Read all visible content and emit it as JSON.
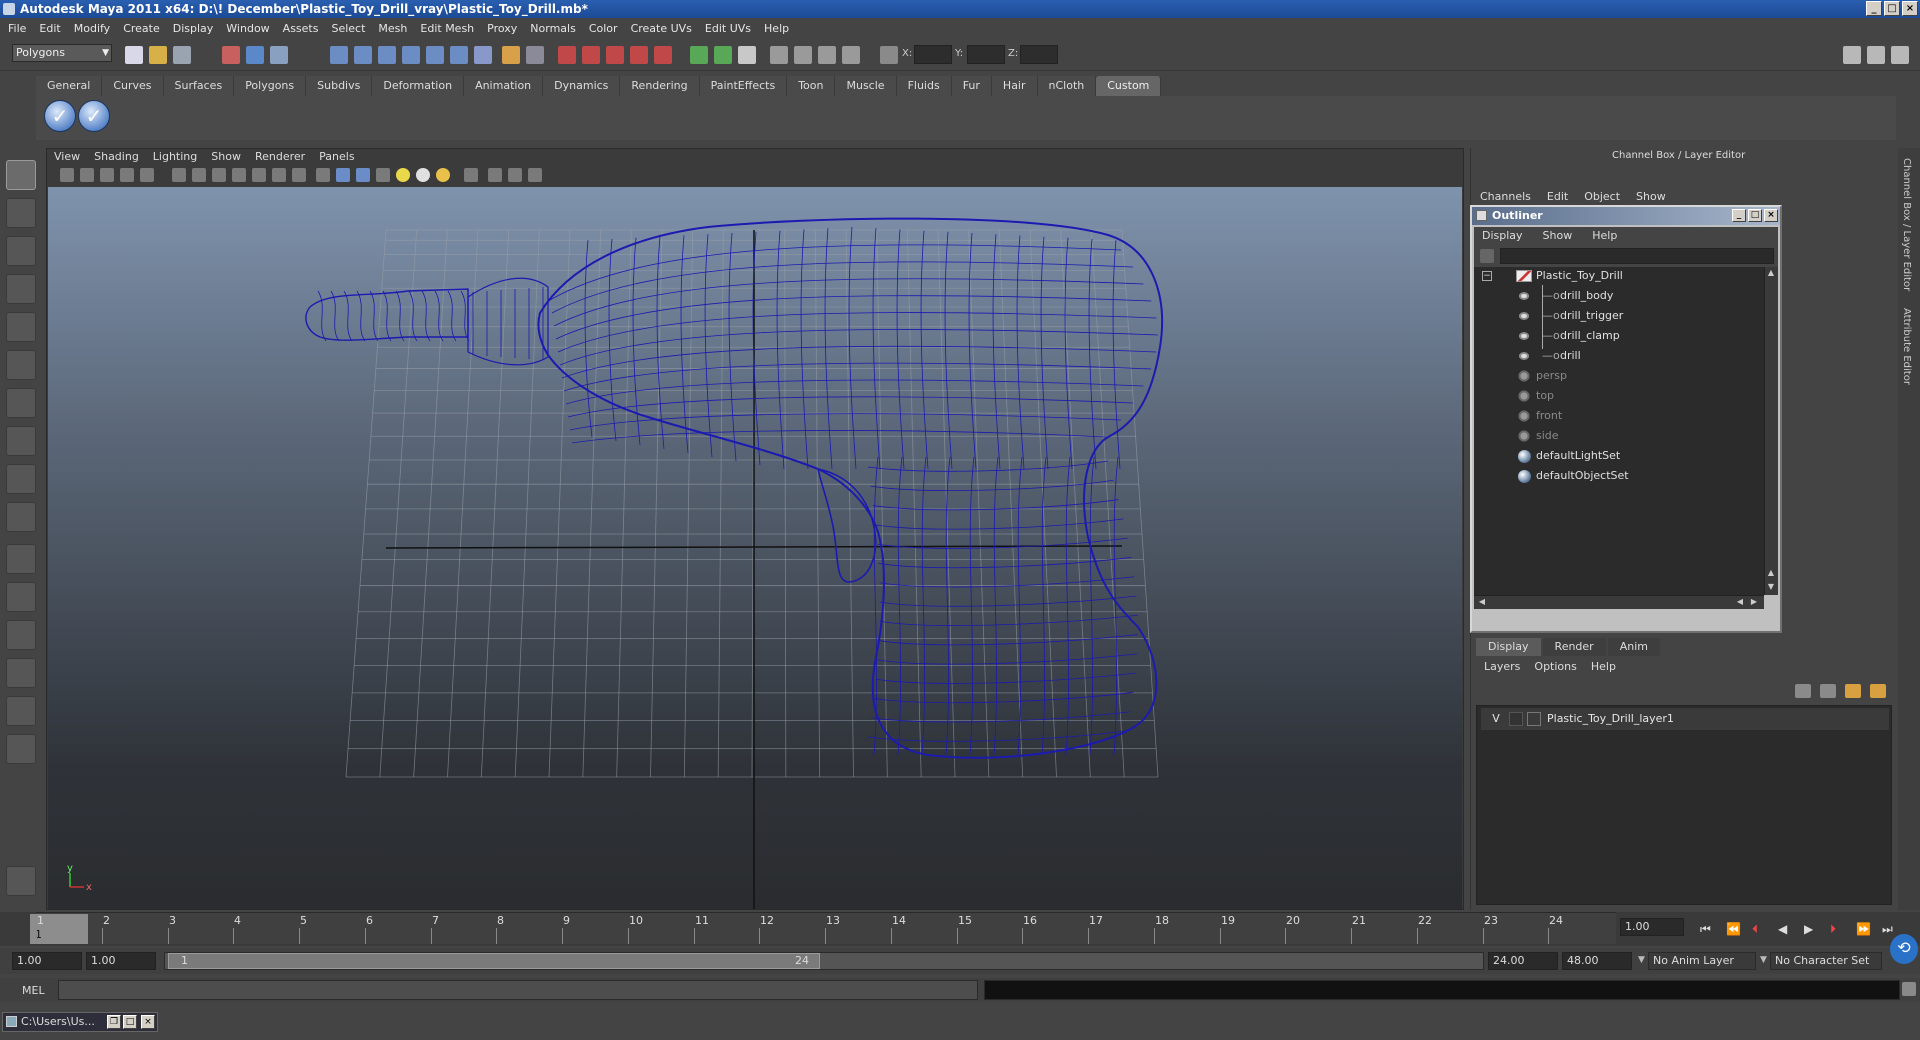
{
  "window": {
    "title": "Autodesk Maya 2011 x64: D:\\! December\\Plastic_Toy_Drill_vray\\Plastic_Toy_Drill.mb*"
  },
  "menubar": [
    "File",
    "Edit",
    "Modify",
    "Create",
    "Display",
    "Window",
    "Assets",
    "Select",
    "Mesh",
    "Edit Mesh",
    "Proxy",
    "Normals",
    "Color",
    "Create UVs",
    "Edit UVs",
    "Help"
  ],
  "statusline": {
    "mode": "Polygons",
    "coord_x": "X:",
    "coord_y": "Y:",
    "coord_z": "Z:"
  },
  "shelf": {
    "tabs": [
      "General",
      "Curves",
      "Surfaces",
      "Polygons",
      "Subdivs",
      "Deformation",
      "Animation",
      "Dynamics",
      "Rendering",
      "PaintEffects",
      "Toon",
      "Muscle",
      "Fluids",
      "Fur",
      "Hair",
      "nCloth",
      "Custom"
    ],
    "active_tab": "Custom",
    "buttons": [
      "check-icon",
      "check-icon"
    ]
  },
  "viewport": {
    "menu": [
      "View",
      "Shading",
      "Lighting",
      "Show",
      "Renderer",
      "Panels"
    ],
    "bg_top": "#7f93ad",
    "bg_bottom": "#2a2c2f",
    "wire_color": "#1c1ab0",
    "grid_color": "#9aa0a8",
    "axis_x": "x",
    "axis_y": "y"
  },
  "channel_box": {
    "title": "Channel Box / Layer Editor",
    "menu": [
      "Channels",
      "Edit",
      "Object",
      "Show"
    ],
    "side_tabs": [
      "Channel Box / Layer Editor",
      "Attribute Editor"
    ]
  },
  "outliner": {
    "title": "Outliner",
    "menu": [
      "Display",
      "Show",
      "Help"
    ],
    "items": [
      {
        "label": "Plastic_Toy_Drill",
        "icon": "group-icon",
        "depth": 0,
        "dim": false
      },
      {
        "label": "drill_body",
        "icon": "mesh-icon",
        "depth": 1,
        "dim": false
      },
      {
        "label": "drill_trigger",
        "icon": "mesh-icon",
        "depth": 1,
        "dim": false
      },
      {
        "label": "drill_clamp",
        "icon": "mesh-icon",
        "depth": 1,
        "dim": false
      },
      {
        "label": "drill",
        "icon": "mesh-icon",
        "depth": 1,
        "dim": false
      },
      {
        "label": "persp",
        "icon": "camera-icon",
        "depth": 0,
        "dim": true
      },
      {
        "label": "top",
        "icon": "camera-icon",
        "depth": 0,
        "dim": true
      },
      {
        "label": "front",
        "icon": "camera-icon",
        "depth": 0,
        "dim": true
      },
      {
        "label": "side",
        "icon": "camera-icon",
        "depth": 0,
        "dim": true
      },
      {
        "label": "defaultLightSet",
        "icon": "set-icon",
        "depth": 0,
        "dim": false
      },
      {
        "label": "defaultObjectSet",
        "icon": "set-icon",
        "depth": 0,
        "dim": false
      }
    ]
  },
  "layer_editor": {
    "tabs": [
      "Display",
      "Render",
      "Anim"
    ],
    "active_tab": "Display",
    "menu": [
      "Layers",
      "Options",
      "Help"
    ],
    "layers": [
      {
        "visible": "V",
        "name": "Plastic_Toy_Drill_layer1"
      }
    ]
  },
  "timeline": {
    "ticks": [
      "1",
      "2",
      "3",
      "4",
      "5",
      "6",
      "7",
      "8",
      "9",
      "10",
      "11",
      "12",
      "13",
      "14",
      "15",
      "16",
      "17",
      "18",
      "19",
      "20",
      "21",
      "22",
      "23",
      "24"
    ],
    "current_frame": "1",
    "current_time": "1.00"
  },
  "range": {
    "start_time": "1.00",
    "playback_start": "1.00",
    "range_start": "1",
    "range_end": "24",
    "playback_end": "24.00",
    "end_time": "48.00",
    "anim_layer": "No Anim Layer",
    "character_set": "No Character Set"
  },
  "command_line": {
    "label": "MEL"
  },
  "taskbar": {
    "item": "C:\\Users\\Us..."
  }
}
